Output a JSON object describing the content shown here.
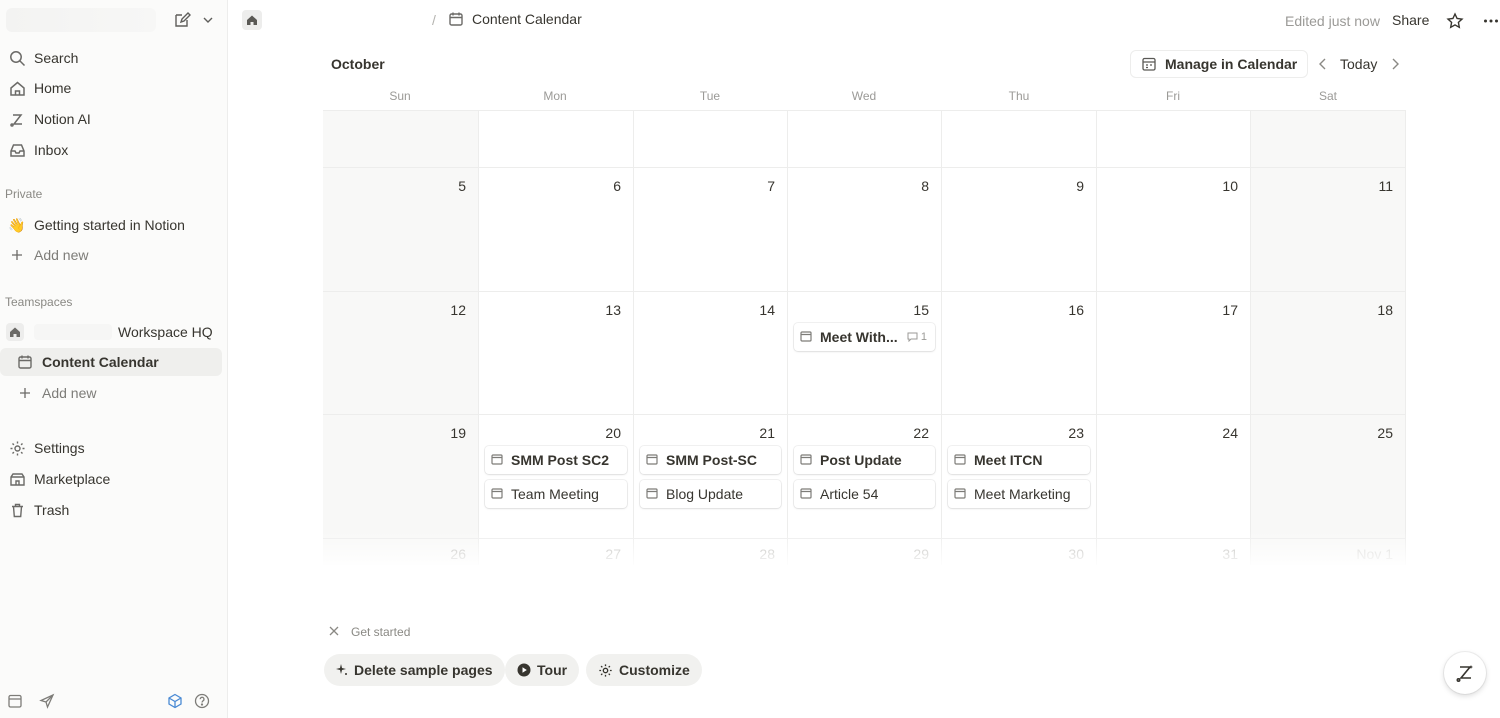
{
  "sidebar": {
    "top_items": [
      {
        "label": "Search",
        "icon": "search-icon"
      },
      {
        "label": "Home",
        "icon": "home-icon"
      },
      {
        "label": "Notion AI",
        "icon": "notion-ai-icon"
      },
      {
        "label": "Inbox",
        "icon": "inbox-icon"
      }
    ],
    "private_heading": "Private",
    "private_items": [
      {
        "label": "Getting started in Notion",
        "icon": "wave-emoji-icon"
      },
      {
        "label": "Add new",
        "icon": "plus-icon"
      }
    ],
    "teamspaces_heading": "Teamspaces",
    "workspace_name": "Workspace HQ",
    "teamspace_items": [
      {
        "label": "Content Calendar",
        "icon": "calendar-icon",
        "active": true
      },
      {
        "label": "Add new",
        "icon": "plus-icon"
      }
    ],
    "bottom_items": [
      {
        "label": "Settings",
        "icon": "gear-icon"
      },
      {
        "label": "Marketplace",
        "icon": "marketplace-icon"
      },
      {
        "label": "Trash",
        "icon": "trash-icon"
      }
    ]
  },
  "topbar": {
    "breadcrumb_sep": "/",
    "page_title": "Content Calendar",
    "edited": "Edited just now",
    "share": "Share"
  },
  "calendar": {
    "month": "October",
    "manage_label": "Manage in Calendar",
    "today_label": "Today",
    "weekdays": [
      "Sun",
      "Mon",
      "Tue",
      "Wed",
      "Thu",
      "Fri",
      "Sat"
    ],
    "weeks": [
      [
        "",
        "",
        "",
        "",
        "",
        "",
        ""
      ],
      [
        "5",
        "6",
        "7",
        "8",
        "9",
        "10",
        "11"
      ],
      [
        "12",
        "13",
        "14",
        "15",
        "16",
        "17",
        "18"
      ],
      [
        "19",
        "20",
        "21",
        "22",
        "23",
        "24",
        "25"
      ],
      [
        "26",
        "27",
        "28",
        "29",
        "30",
        "31",
        "Nov 1"
      ]
    ],
    "events": {
      "meet_with": {
        "title": "Meet With...",
        "comments": "1"
      },
      "smm_sc2": {
        "title": "SMM Post SC2"
      },
      "team_meeting": {
        "title": "Team Meeting"
      },
      "smm_sc": {
        "title": "SMM Post-SC"
      },
      "blog_update": {
        "title": "Blog Update"
      },
      "post_update": {
        "title": "Post Update"
      },
      "article_54": {
        "title": "Article 54"
      },
      "meet_itcn": {
        "title": "Meet ITCN"
      },
      "meet_marketing": {
        "title": "Meet Marketing"
      }
    }
  },
  "get_started": {
    "label": "Get started",
    "delete_label": "Delete sample pages",
    "tour_label": "Tour",
    "customize_label": "Customize"
  },
  "colors": {
    "sidebar_bg": "#fbfbfa",
    "text": "#37352f",
    "muted": "#9b9a97",
    "weekend_bg": "#f8f8f7"
  }
}
